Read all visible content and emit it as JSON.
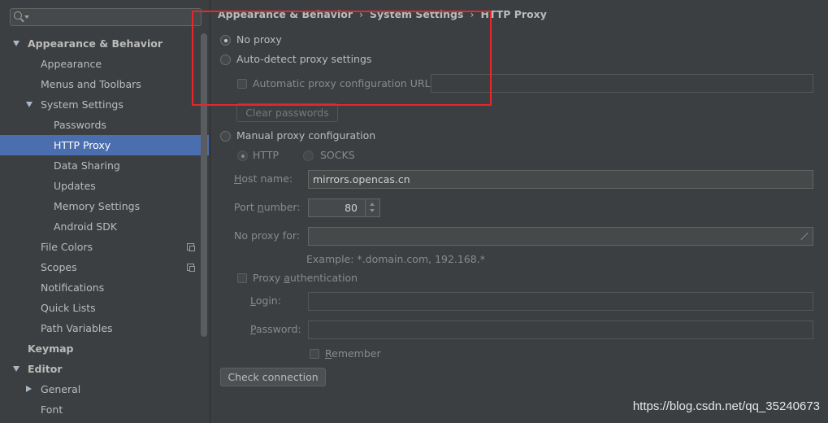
{
  "search": {
    "placeholder": ""
  },
  "sidebar": {
    "items": [
      {
        "label": "Appearance & Behavior",
        "level": 0,
        "expanded": true,
        "bold": true
      },
      {
        "label": "Appearance",
        "level": 1
      },
      {
        "label": "Menus and Toolbars",
        "level": 1
      },
      {
        "label": "System Settings",
        "level": 1,
        "expanded": true
      },
      {
        "label": "Passwords",
        "level": 2
      },
      {
        "label": "HTTP Proxy",
        "level": 2,
        "selected": true
      },
      {
        "label": "Data Sharing",
        "level": 2
      },
      {
        "label": "Updates",
        "level": 2
      },
      {
        "label": "Memory Settings",
        "level": 2
      },
      {
        "label": "Android SDK",
        "level": 2
      },
      {
        "label": "File Colors",
        "level": 1,
        "copyIcon": true
      },
      {
        "label": "Scopes",
        "level": 1,
        "copyIcon": true
      },
      {
        "label": "Notifications",
        "level": 1
      },
      {
        "label": "Quick Lists",
        "level": 1
      },
      {
        "label": "Path Variables",
        "level": 1
      },
      {
        "label": "Keymap",
        "level": 0,
        "bold": true
      },
      {
        "label": "Editor",
        "level": 0,
        "expanded": true,
        "bold": true
      },
      {
        "label": "General",
        "level": 1,
        "collapsed": true
      },
      {
        "label": "Font",
        "level": 1
      }
    ]
  },
  "breadcrumb": [
    "Appearance & Behavior",
    "System Settings",
    "HTTP Proxy"
  ],
  "breadcrumb_sep": "›",
  "proxy": {
    "no_proxy_label": "No proxy",
    "no_proxy_selected": true,
    "auto_detect_label": "Auto-detect proxy settings",
    "auto_config_url_label": "Automatic proxy configuration URL:",
    "auto_config_url_value": "",
    "clear_passwords_label": "Clear passwords",
    "manual_label": "Manual proxy configuration",
    "http_label": "HTTP",
    "socks_label": "SOCKS",
    "host_label_pre": "",
    "host_label_u": "H",
    "host_label_post": "ost name:",
    "host_value": "mirrors.opencas.cn",
    "port_label_pre": "Port ",
    "port_label_u": "n",
    "port_label_post": "umber:",
    "port_value": "80",
    "no_proxy_for_label": "No proxy for:",
    "no_proxy_for_value": "",
    "example_text": "Example: *.domain.com, 192.168.*",
    "auth_label_pre": "Proxy ",
    "auth_label_u": "a",
    "auth_label_post": "uthentication",
    "login_label_pre": "",
    "login_label_u": "L",
    "login_label_post": "ogin:",
    "login_value": "",
    "password_label_pre": "",
    "password_label_u": "P",
    "password_label_post": "assword:",
    "password_value": "",
    "remember_label_pre": "",
    "remember_label_u": "R",
    "remember_label_post": "emember",
    "check_connection_label": "Check connection"
  },
  "watermark": "https://blog.csdn.net/qq_35240673",
  "colors": {
    "selection": "#4b6eaf",
    "highlight_box": "#e8262b",
    "background": "#3c3f41"
  }
}
